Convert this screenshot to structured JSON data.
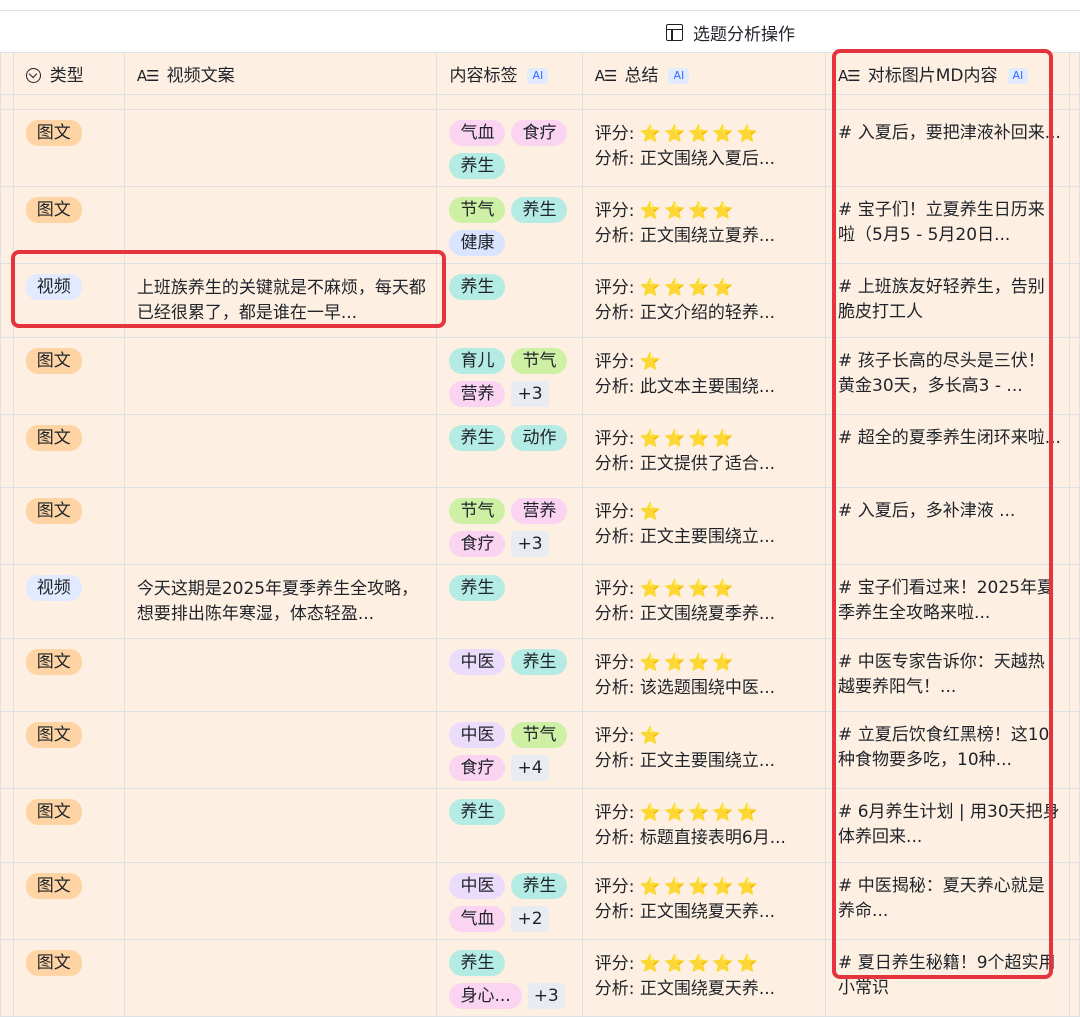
{
  "group_header": {
    "label": "选题分析操作"
  },
  "columns": {
    "type": "类型",
    "video_script": "视频文案",
    "content_tags": "内容标签",
    "summary": "总结",
    "md_content": "对标图片MD内容",
    "ai_badge": "AI"
  },
  "summary_labels": {
    "score": "评分:",
    "analysis": "分析:"
  },
  "rows": [
    {
      "type": "图文",
      "type_kind": "graphic",
      "video_script": "",
      "tags": [
        {
          "text": "气血",
          "color": "#fbd4f2"
        },
        {
          "text": "食疗",
          "color": "#fbd4f2"
        },
        {
          "text": "养生",
          "color": "#b4ece4"
        }
      ],
      "more": "",
      "stars": "⭐⭐⭐⭐⭐",
      "analysis": "正文围绕入夏后...",
      "md": "# 入夏后，要把津液补回来..."
    },
    {
      "type": "图文",
      "type_kind": "graphic",
      "video_script": "",
      "tags": [
        {
          "text": "节气",
          "color": "#cdf0a5"
        },
        {
          "text": "养生",
          "color": "#b4ece4"
        },
        {
          "text": "健康",
          "color": "#d9e4ff"
        }
      ],
      "more": "",
      "stars": "⭐⭐⭐⭐",
      "analysis": "正文围绕立夏养...",
      "md": "# 宝子们！立夏养生日历来啦（5月5 - 5月20日..."
    },
    {
      "type": "视频",
      "type_kind": "video",
      "video_script": "上班族养生的关键就是不麻烦，每天都已经很累了，都是谁在一早...",
      "tags": [
        {
          "text": "养生",
          "color": "#b4ece4"
        }
      ],
      "more": "",
      "stars": "⭐⭐⭐⭐",
      "analysis": "正文介绍的轻养...",
      "md": "# 上班族友好轻养生，告别脆皮打工人"
    },
    {
      "type": "图文",
      "type_kind": "graphic",
      "video_script": "",
      "tags": [
        {
          "text": "育儿",
          "color": "#b4ece4"
        },
        {
          "text": "节气",
          "color": "#cdf0a5"
        },
        {
          "text": "营养",
          "color": "#fbd4f2"
        }
      ],
      "more": "+3",
      "stars": "⭐",
      "analysis": "此文本主要围绕...",
      "md": "# 孩子长高的尽头是三伏！黄金30天，多长高3 - ..."
    },
    {
      "type": "图文",
      "type_kind": "graphic",
      "video_script": "",
      "tags": [
        {
          "text": "养生",
          "color": "#b4ece4"
        },
        {
          "text": "动作",
          "color": "#b4ece4"
        }
      ],
      "more": "",
      "stars": "⭐⭐⭐⭐",
      "analysis": "正文提供了适合...",
      "md": "# 超全的夏季养生闭环来啦..."
    },
    {
      "type": "图文",
      "type_kind": "graphic",
      "video_script": "",
      "tags": [
        {
          "text": "节气",
          "color": "#cdf0a5"
        },
        {
          "text": "营养",
          "color": "#fbd4f2"
        },
        {
          "text": "食疗",
          "color": "#fbd4f2"
        }
      ],
      "more": "+3",
      "stars": "⭐",
      "analysis": "正文主要围绕立...",
      "md": "# 入夏后，多补津液 ..."
    },
    {
      "type": "视频",
      "type_kind": "video",
      "video_script": "今天这期是2025年夏季养生全攻略，想要排出陈年寒湿，体态轻盈...",
      "tags": [
        {
          "text": "养生",
          "color": "#b4ece4"
        }
      ],
      "more": "",
      "stars": "⭐⭐⭐⭐",
      "analysis": "正文围绕夏季养...",
      "md": "# 宝子们看过来！2025年夏季养生全攻略来啦..."
    },
    {
      "type": "图文",
      "type_kind": "graphic",
      "video_script": "",
      "tags": [
        {
          "text": "中医",
          "color": "#ecdcfb"
        },
        {
          "text": "养生",
          "color": "#b4ece4"
        }
      ],
      "more": "",
      "stars": "⭐⭐⭐⭐",
      "analysis": "该选题围绕中医...",
      "md": "# 中医专家告诉你：天越热越要养阳气！..."
    },
    {
      "type": "图文",
      "type_kind": "graphic",
      "video_script": "",
      "tags": [
        {
          "text": "中医",
          "color": "#ecdcfb"
        },
        {
          "text": "节气",
          "color": "#cdf0a5"
        },
        {
          "text": "食疗",
          "color": "#fbd4f2"
        }
      ],
      "more": "+4",
      "stars": "⭐",
      "analysis": "正文主要围绕立...",
      "md": "# 立夏后饮食红黑榜！这10种食物要多吃，10种..."
    },
    {
      "type": "图文",
      "type_kind": "graphic",
      "video_script": "",
      "tags": [
        {
          "text": "养生",
          "color": "#b4ece4"
        }
      ],
      "more": "",
      "stars": "⭐⭐⭐⭐⭐",
      "analysis": "标题直接表明6月...",
      "md": "# 6月养生计划 | 用30天把身体养回来..."
    },
    {
      "type": "图文",
      "type_kind": "graphic",
      "video_script": "",
      "tags": [
        {
          "text": "中医",
          "color": "#ecdcfb"
        },
        {
          "text": "养生",
          "color": "#b4ece4"
        },
        {
          "text": "气血",
          "color": "#fbd4f2"
        }
      ],
      "more": "+2",
      "stars": "⭐⭐⭐⭐⭐",
      "analysis": "正文围绕夏天养...",
      "md": "# 中医揭秘：夏天养心就是养命..."
    },
    {
      "type": "图文",
      "type_kind": "graphic",
      "video_script": "",
      "tags": [
        {
          "text": "养生",
          "color": "#b4ece4"
        },
        {
          "text": "身心...",
          "color": "#fbd4f2"
        }
      ],
      "more": "+3",
      "stars": "⭐⭐⭐⭐⭐",
      "analysis": "正文围绕夏天养...",
      "md": "# 夏日养生秘籍！9个超实用小常识"
    }
  ]
}
